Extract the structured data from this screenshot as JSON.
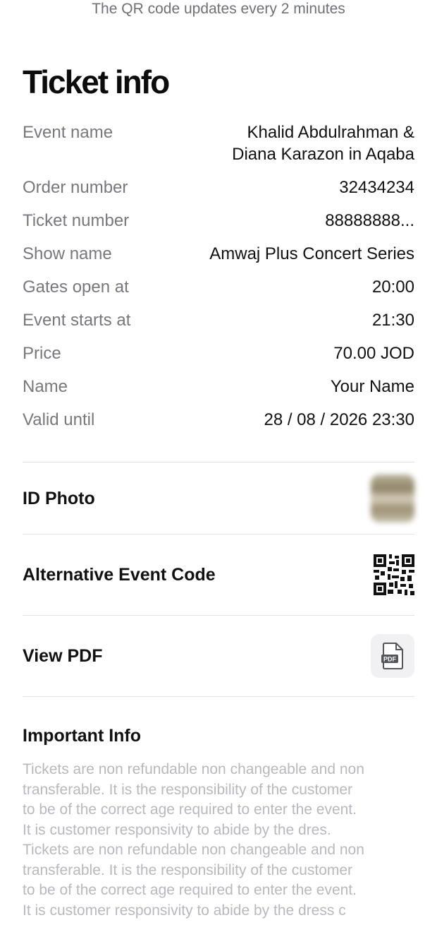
{
  "qr_note": "The QR code updates every 2 minutes",
  "ticket_info": {
    "title": "Ticket info",
    "rows": [
      {
        "label": "Event name",
        "value": "Khalid Abdulrahman & Diana Karazon in Aqaba"
      },
      {
        "label": "Order number",
        "value": "32434234"
      },
      {
        "label": "Ticket number",
        "value": "88888888..."
      },
      {
        "label": "Show name",
        "value": "Amwaj Plus Concert Series"
      },
      {
        "label": "Gates open at",
        "value": "20:00"
      },
      {
        "label": "Event starts at",
        "value": "21:30"
      },
      {
        "label": "Price",
        "value": "70.00 JOD"
      },
      {
        "label": "Name",
        "value": "Your Name"
      },
      {
        "label": "Valid until",
        "value": "28 / 08 / 2026  23:30"
      }
    ]
  },
  "actions": {
    "id_photo_label": "ID Photo",
    "alt_code_label": "Alternative Event Code",
    "view_pdf_label": "View PDF",
    "pdf_icon_text": "PDF"
  },
  "important": {
    "title": "Important Info",
    "body": "Tickets are non refundable non changeable and non\ntransferable. It is the responsibility of the customer\nto be of the correct age required to enter the event.\nIt is customer responsivity to abide by the dres.\nTickets are non refundable non changeable and non\ntransferable. It is the responsibility of the customer\nto be of the correct age required to enter the event.\nIt is customer responsivity to abide by the dress c"
  },
  "icons": {
    "qr": "qr-code-icon",
    "pdf": "pdf-file-icon"
  },
  "colors": {
    "label_gray": "#77787e",
    "body_gray": "#b8b9c0",
    "divider": "#e2e2e6",
    "pdf_button_bg": "#f1f1f4"
  }
}
